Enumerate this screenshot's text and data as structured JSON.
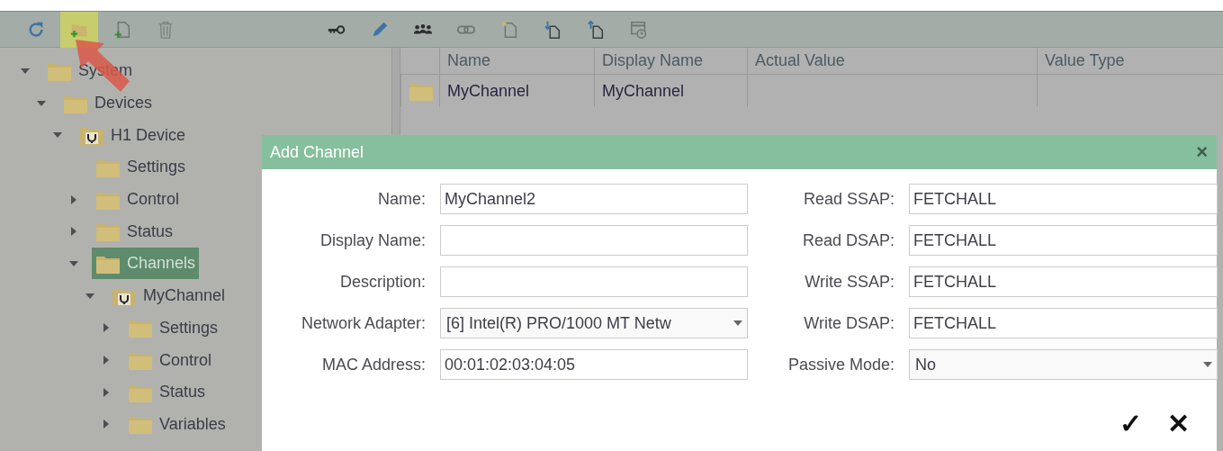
{
  "toolbar": {
    "buttons": [
      {
        "kind": "refresh",
        "highlighted": false
      },
      {
        "kind": "add-folder",
        "highlighted": true
      },
      {
        "kind": "add-file",
        "highlighted": false
      },
      {
        "kind": "delete",
        "highlighted": false
      },
      {
        "kind": "key",
        "highlighted": false
      },
      {
        "kind": "edit",
        "highlighted": false
      },
      {
        "kind": "users",
        "highlighted": false
      },
      {
        "kind": "link",
        "highlighted": false
      },
      {
        "kind": "new-document",
        "highlighted": false
      },
      {
        "kind": "import",
        "highlighted": false
      },
      {
        "kind": "export",
        "highlighted": false
      },
      {
        "kind": "schedule",
        "highlighted": false
      }
    ]
  },
  "tree": [
    {
      "label": "System",
      "kind": "folder",
      "expanded": true,
      "selected": false,
      "children": [
        {
          "label": "Devices",
          "kind": "folder",
          "expanded": true,
          "selected": false,
          "children": [
            {
              "label": "H1 Device",
              "kind": "device",
              "expanded": true,
              "selected": false,
              "children": [
                {
                  "label": "Settings",
                  "kind": "folder",
                  "selected": false
                },
                {
                  "label": "Control",
                  "kind": "folder",
                  "expanded": false,
                  "selected": false
                },
                {
                  "label": "Status",
                  "kind": "folder",
                  "expanded": false,
                  "selected": false
                },
                {
                  "label": "Channels",
                  "kind": "folder",
                  "expanded": true,
                  "selected": true,
                  "children": [
                    {
                      "label": "MyChannel",
                      "kind": "device",
                      "expanded": true,
                      "selected": false,
                      "children": [
                        {
                          "label": "Settings",
                          "kind": "folder",
                          "expanded": false,
                          "selected": false
                        },
                        {
                          "label": "Control",
                          "kind": "folder",
                          "expanded": false,
                          "selected": false
                        },
                        {
                          "label": "Status",
                          "kind": "folder",
                          "expanded": false,
                          "selected": false
                        },
                        {
                          "label": "Variables",
                          "kind": "folder",
                          "expanded": false,
                          "selected": false
                        }
                      ]
                    }
                  ]
                }
              ]
            }
          ]
        }
      ]
    }
  ],
  "table": {
    "columns": [
      "Name",
      "Display Name",
      "Actual Value",
      "Value Type"
    ],
    "rows": [
      {
        "kind": "folder",
        "name": "MyChannel",
        "display_name": "MyChannel"
      }
    ]
  },
  "dialog": {
    "title": "Add Channel",
    "close": "×",
    "left_fields": [
      {
        "label": "Name:",
        "kind": "text",
        "value": "MyChannel2"
      },
      {
        "label": "Display Name:",
        "kind": "text"
      },
      {
        "label": "Description:",
        "kind": "text"
      },
      {
        "label": "Network Adapter:",
        "kind": "select",
        "value": "[6] Intel(R) PRO/1000 MT Netw"
      },
      {
        "label": "MAC Address:",
        "kind": "text",
        "value": "00:01:02:03:04:05"
      }
    ],
    "right_fields": [
      {
        "label": "Read SSAP:",
        "kind": "text",
        "value": "FETCHALL"
      },
      {
        "label": "Read DSAP:",
        "kind": "text",
        "value": "FETCHALL"
      },
      {
        "label": "Write SSAP:",
        "kind": "text",
        "value": "FETCHALL"
      },
      {
        "label": "Write DSAP:",
        "kind": "text",
        "value": "FETCHALL"
      },
      {
        "label": "Passive Mode:",
        "kind": "select",
        "value": "No"
      }
    ],
    "ok": "✓",
    "cancel": "✕"
  }
}
